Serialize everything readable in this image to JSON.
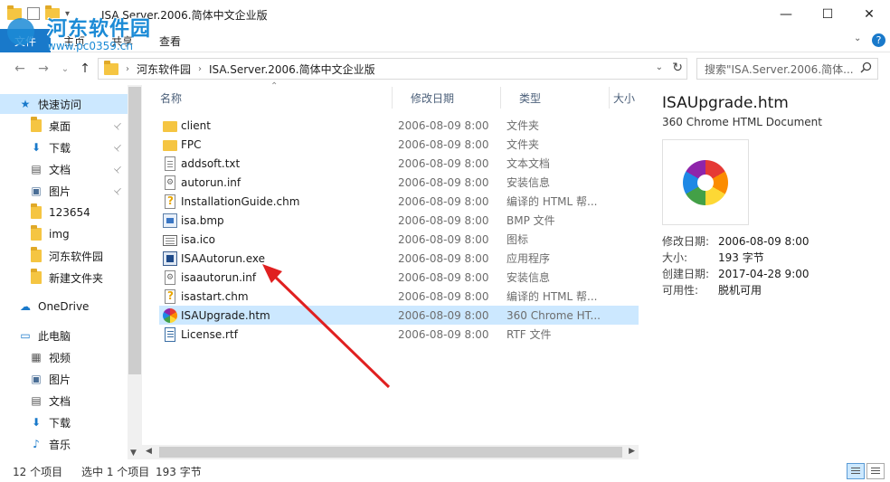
{
  "window": {
    "title": "ISA.Server.2006.简体中文企业版",
    "min_glyph": "—",
    "max_glyph": "☐",
    "close_glyph": "✕"
  },
  "watermark": {
    "title": "河东软件园",
    "url": "www.pc0359.cn"
  },
  "ribbon": {
    "file": "文件",
    "tabs": [
      "主页",
      "共享",
      "查看"
    ],
    "caret": "⌄",
    "help": "?"
  },
  "nav": {
    "back": "←",
    "forward": "→",
    "recent": "⌄",
    "up": "↑",
    "breadcrumb": [
      "河东软件园",
      "ISA.Server.2006.简体中文企业版"
    ],
    "sep": "›",
    "dropdown": "⌄",
    "refresh": "↻",
    "search_placeholder": "搜索\"ISA.Server.2006.简体...",
    "search_icon": "search-icon"
  },
  "sidebar": {
    "items": [
      {
        "label": "快速访问",
        "icon": "star-icon",
        "glyph": "★",
        "color": "#1979ca",
        "selected": true,
        "pinned": false
      },
      {
        "label": "桌面",
        "icon": "folder-icon",
        "glyph": "",
        "color": "#f5c542",
        "selected": false,
        "pinned": true
      },
      {
        "label": "下载",
        "icon": "download-icon",
        "glyph": "⬇",
        "color": "#1979ca",
        "selected": false,
        "pinned": true
      },
      {
        "label": "文档",
        "icon": "document-icon",
        "glyph": "▤",
        "color": "#555555",
        "selected": false,
        "pinned": true
      },
      {
        "label": "图片",
        "icon": "picture-icon",
        "glyph": "▣",
        "color": "#4a6e96",
        "selected": false,
        "pinned": true
      },
      {
        "label": "123654",
        "icon": "folder-icon",
        "glyph": "",
        "color": "#f5c542",
        "selected": false,
        "pinned": false
      },
      {
        "label": "img",
        "icon": "folder-icon",
        "glyph": "",
        "color": "#f5c542",
        "selected": false,
        "pinned": false
      },
      {
        "label": "河东软件园",
        "icon": "folder-icon",
        "glyph": "",
        "color": "#f5c542",
        "selected": false,
        "pinned": false
      },
      {
        "label": "新建文件夹",
        "icon": "folder-icon",
        "glyph": "",
        "color": "#f5c542",
        "selected": false,
        "pinned": false
      },
      {
        "label": "OneDrive",
        "icon": "cloud-icon",
        "glyph": "☁",
        "color": "#1979ca",
        "selected": false,
        "pinned": false
      },
      {
        "label": "此电脑",
        "icon": "computer-icon",
        "glyph": "▭",
        "color": "#1979ca",
        "selected": false,
        "pinned": false
      },
      {
        "label": "视频",
        "icon": "video-icon",
        "glyph": "▦",
        "color": "#555555",
        "selected": false,
        "pinned": false
      },
      {
        "label": "图片",
        "icon": "picture-icon",
        "glyph": "▣",
        "color": "#4a6e96",
        "selected": false,
        "pinned": false
      },
      {
        "label": "文档",
        "icon": "document-icon",
        "glyph": "▤",
        "color": "#555555",
        "selected": false,
        "pinned": false
      },
      {
        "label": "下载",
        "icon": "download-icon",
        "glyph": "⬇",
        "color": "#1979ca",
        "selected": false,
        "pinned": false
      },
      {
        "label": "音乐",
        "icon": "music-icon",
        "glyph": "♪",
        "color": "#1979ca",
        "selected": false,
        "pinned": false
      }
    ],
    "pin_glyph": "📌"
  },
  "filelist": {
    "columns": [
      "名称",
      "修改日期",
      "类型",
      "大小"
    ],
    "sort_glyph": "⌃",
    "rows": [
      {
        "name": "client",
        "date": "2006-08-09 8:00",
        "type": "文件夹",
        "icon": "folder",
        "selected": false
      },
      {
        "name": "FPC",
        "date": "2006-08-09 8:00",
        "type": "文件夹",
        "icon": "folder",
        "selected": false
      },
      {
        "name": "addsoft.txt",
        "date": "2006-08-09 8:00",
        "type": "文本文档",
        "icon": "doc",
        "selected": false
      },
      {
        "name": "autorun.inf",
        "date": "2006-08-09 8:00",
        "type": "安装信息",
        "icon": "gear",
        "selected": false
      },
      {
        "name": "InstallationGuide.chm",
        "date": "2006-08-09 8:00",
        "type": "编译的 HTML 帮...",
        "icon": "chm",
        "selected": false
      },
      {
        "name": "isa.bmp",
        "date": "2006-08-09 8:00",
        "type": "BMP 文件",
        "icon": "bmp",
        "selected": false
      },
      {
        "name": "isa.ico",
        "date": "2006-08-09 8:00",
        "type": "图标",
        "icon": "ico",
        "selected": false
      },
      {
        "name": "ISAAutorun.exe",
        "date": "2006-08-09 8:00",
        "type": "应用程序",
        "icon": "exe",
        "selected": false
      },
      {
        "name": "isaautorun.inf",
        "date": "2006-08-09 8:00",
        "type": "安装信息",
        "icon": "gear",
        "selected": false
      },
      {
        "name": "isastart.chm",
        "date": "2006-08-09 8:00",
        "type": "编译的 HTML 帮...",
        "icon": "chm",
        "selected": false
      },
      {
        "name": "ISAUpgrade.htm",
        "date": "2006-08-09 8:00",
        "type": "360 Chrome HT...",
        "icon": "360",
        "selected": true
      },
      {
        "name": "License.rtf",
        "date": "2006-08-09 8:00",
        "type": "RTF 文件",
        "icon": "rtf",
        "selected": false
      }
    ]
  },
  "details": {
    "name": "ISAUpgrade.htm",
    "type": "360 Chrome HTML Document",
    "props": [
      {
        "k": "修改日期:",
        "v": "2006-08-09 8:00"
      },
      {
        "k": "大小:",
        "v": "193 字节"
      },
      {
        "k": "创建日期:",
        "v": "2017-04-28 9:00"
      },
      {
        "k": "可用性:",
        "v": "脱机可用"
      }
    ]
  },
  "status": {
    "count": "12 个项目",
    "selected": "选中 1 个项目",
    "size": "193 字节"
  },
  "colors": {
    "accent": "#1979ca",
    "selection": "#cce8ff",
    "annotation_arrow": "#e02020"
  }
}
